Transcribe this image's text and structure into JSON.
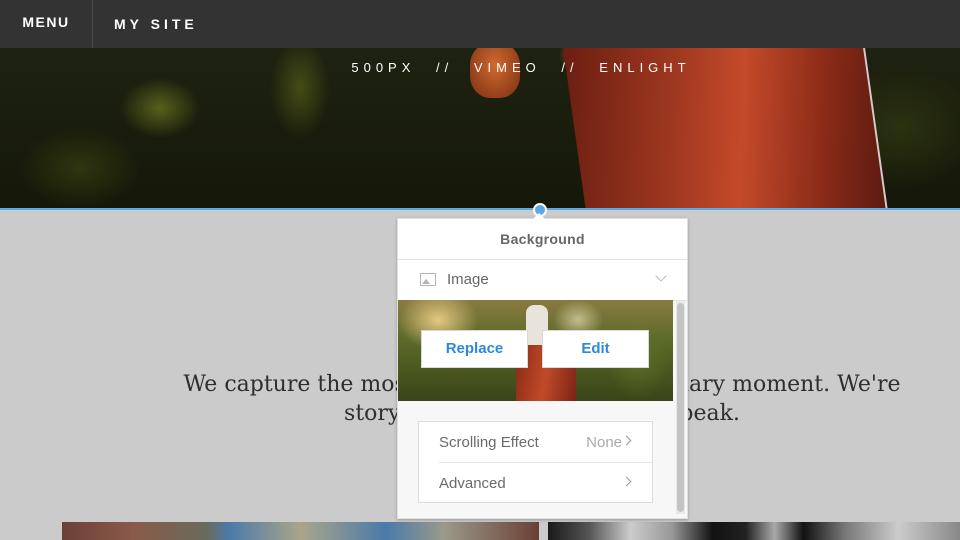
{
  "topbar": {
    "menu_label": "MENU",
    "site_title": "MY SITE"
  },
  "hero": {
    "social_links": [
      "500PX",
      "//",
      "VIMEO",
      "//",
      "ENLIGHT"
    ]
  },
  "body": {
    "text_line1": "We capture the most ordinary and extraordinary moment. We're",
    "text_line2": "storytellers; we let our work speak."
  },
  "panel": {
    "title": "Background",
    "type_selector": {
      "icon": "image-icon",
      "selected": "Image"
    },
    "replace_label": "Replace",
    "edit_label": "Edit",
    "options": [
      {
        "label": "Scrolling Effect",
        "value": "None"
      },
      {
        "label": "Advanced",
        "value": ""
      }
    ]
  },
  "colors": {
    "accent": "#5aa9e6",
    "button_text": "#2e8ad8",
    "topbar": "#333333",
    "section_bg": "#cbcbcb"
  }
}
